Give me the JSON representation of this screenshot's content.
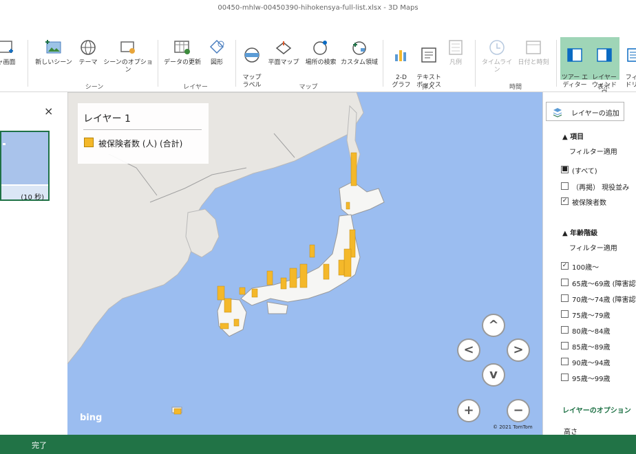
{
  "window": {
    "title": "00450-mhlw-00450390-hihokensya-full-list.xlsx - 3D Maps"
  },
  "ribbon": {
    "buttons": [
      {
        "label": "ャ画面",
        "icon": "capture-screen-icon"
      },
      {
        "label": "新しいシーン",
        "icon": "new-scene-icon"
      },
      {
        "label": "テーマ",
        "icon": "theme-globe-icon"
      },
      {
        "label": "シーンのオプション",
        "icon": "scene-options-icon"
      },
      {
        "label": "データの更新",
        "icon": "refresh-data-icon"
      },
      {
        "label": "図形",
        "icon": "shapes-icon"
      },
      {
        "label": "マップ\nラベル",
        "icon": "map-labels-icon"
      },
      {
        "label": "平面マップ",
        "icon": "flat-map-icon"
      },
      {
        "label": "場所の検索",
        "icon": "find-location-icon"
      },
      {
        "label": "カスタム領域",
        "icon": "custom-regions-icon"
      },
      {
        "label": "2-D\nグラフ",
        "icon": "2d-chart-icon"
      },
      {
        "label": "テキスト\nボックス",
        "icon": "text-box-icon"
      },
      {
        "label": "凡例",
        "icon": "legend-icon"
      },
      {
        "label": "タイムライン",
        "icon": "timeline-icon"
      },
      {
        "label": "日付と時刻",
        "icon": "date-time-icon"
      },
      {
        "label": "ツアー エ\nディター",
        "icon": "tour-editor-icon"
      },
      {
        "label": "レイヤー\nウィンドウ",
        "icon": "layer-pane-icon"
      },
      {
        "label": "フィー\nドリス",
        "icon": "field-list-icon"
      }
    ],
    "groups": [
      "シーン",
      "レイヤー",
      "マップ",
      "挿入",
      "時間",
      "表示"
    ]
  },
  "left_panel": {
    "close_label": "×",
    "scene_duration": "(10 秒)"
  },
  "legend": {
    "title": "レイヤー 1",
    "series_label": "被保険者数 (人) (合計)",
    "color": "#f4b82a"
  },
  "map": {
    "bing_label": "bing",
    "copyright": "© 2021 TomTom"
  },
  "nav": {
    "up": "^",
    "left": "<",
    "right": ">",
    "down": "v",
    "zoom_in": "+",
    "zoom_out": "−"
  },
  "right_panel": {
    "add_layer_label": "レイヤーの追加",
    "sections": [
      {
        "title": "▲ 項目",
        "filter_label": "フィルター適用",
        "items": [
          {
            "label": "(すべて)",
            "state": "partial"
          },
          {
            "label": "（再掲）  現役並み",
            "state": "unchecked"
          },
          {
            "label": "被保険者数",
            "state": "checked"
          }
        ]
      },
      {
        "title": "▲ 年齢階級",
        "filter_label": "フィルター適用",
        "items": [
          {
            "label": "100歳～",
            "state": "checked"
          },
          {
            "label": "65歳～69歳 (障害認",
            "state": "unchecked"
          },
          {
            "label": "70歳～74歳 (障害認",
            "state": "unchecked"
          },
          {
            "label": "75歳～79歳",
            "state": "unchecked"
          },
          {
            "label": "80歳～84歳",
            "state": "unchecked"
          },
          {
            "label": "85歳～89歳",
            "state": "unchecked"
          },
          {
            "label": "90歳～94歳",
            "state": "unchecked"
          },
          {
            "label": "95歳～99歳",
            "state": "unchecked"
          }
        ]
      }
    ],
    "layer_options_label": "レイヤーのオプション",
    "height_label": "高さ"
  },
  "status": {
    "text": "完了"
  }
}
